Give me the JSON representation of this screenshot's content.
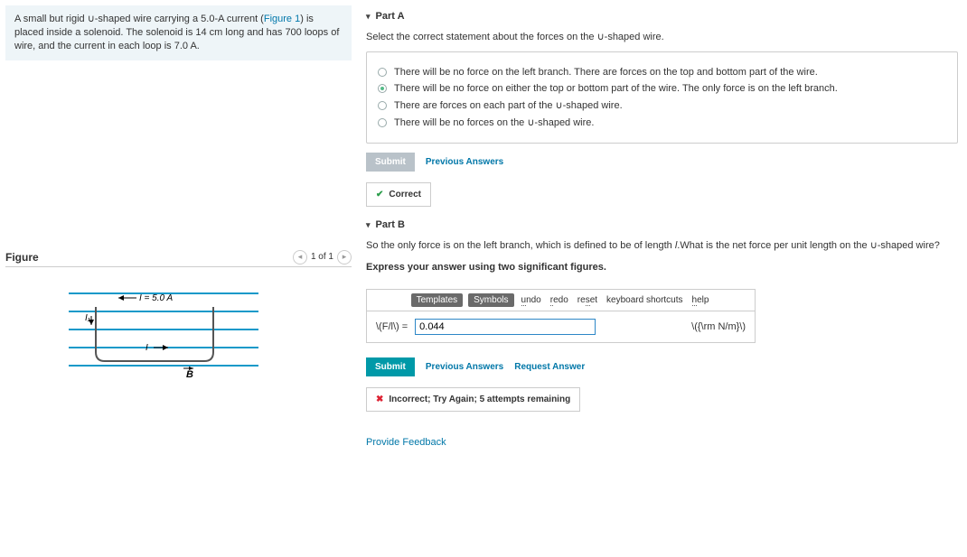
{
  "problem": {
    "text_prefix": "A small but rigid ",
    "ushape1": "∪",
    "text_mid1": "-shaped wire carrying a 5.0-A current (",
    "fig_link": "Figure 1",
    "text_mid2": ") is placed inside a solenoid. The solenoid is 14 cm long and has 700 loops of wire, and the current in each loop is 7.0 A."
  },
  "figure": {
    "title": "Figure",
    "counter": "1 of 1",
    "label_current": "I = 5.0 A",
    "label_I1": "I₁",
    "label_arrow": "I →",
    "label_B": "B"
  },
  "partA": {
    "title": "Part A",
    "prompt_pre": "Select the correct statement about the forces on the ",
    "ushape": "∪",
    "prompt_post": "-shaped wire.",
    "choices": [
      {
        "text": "There will be no force on the left branch. There are forces on the top and bottom part of the wire.",
        "selected": false
      },
      {
        "text": "There will be no force on either the top or bottom part of the wire. The only force is on the left branch.",
        "selected": true
      },
      {
        "text_pre": "There are forces on each part of the ",
        "ushape": "∪",
        "text_post": "-shaped wire.",
        "selected": false
      },
      {
        "text_pre": "There will be no forces on the ",
        "ushape": "∪",
        "text_post": "-shaped wire.",
        "selected": false
      }
    ],
    "submit_label": "Submit",
    "prev_label": "Previous Answers",
    "status": "Correct"
  },
  "partB": {
    "title": "Part B",
    "prompt_pre": "So the only force is on the left branch, which is defined to be of length ",
    "prompt_var": "l",
    "prompt_mid": ".What is the net force per unit length on the ",
    "ushape": "∪",
    "prompt_post": "-shaped wire?",
    "express_line": "Express your answer using two significant figures.",
    "toolbar": {
      "templates": "Templates",
      "symbols": "Symbols",
      "undo": "undo",
      "redo": "redo",
      "reset": "reset",
      "kb": "keyboard shortcuts",
      "help": "help"
    },
    "var_label": "\\(F/l\\) = ",
    "input_value": "0.044",
    "unit_label": "\\({\\rm N/m}\\)",
    "submit_label": "Submit",
    "prev_label": "Previous Answers",
    "request_label": "Request Answer",
    "status": "Incorrect; Try Again; 5 attempts remaining"
  },
  "feedback": "Provide Feedback"
}
